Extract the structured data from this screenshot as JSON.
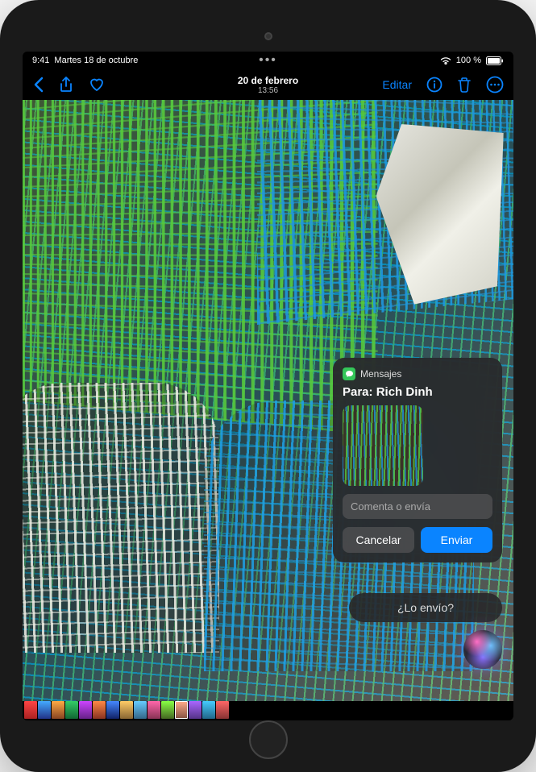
{
  "status": {
    "time": "9:41",
    "date_short": "Martes 18 de octubre",
    "battery_percent": "100 %"
  },
  "nav": {
    "photo_date": "20 de febrero",
    "photo_time": "13:56",
    "edit_label": "Editar"
  },
  "compose": {
    "app_name": "Mensajes",
    "to_prefix": "Para:",
    "recipient": "Rich Dinh",
    "input_placeholder": "Comenta o envía",
    "cancel_label": "Cancelar",
    "send_label": "Enviar"
  },
  "siri": {
    "followup_text": "¿Lo envío?"
  },
  "colors": {
    "accent": "#0a84ff",
    "messages_green": "#34c759"
  }
}
